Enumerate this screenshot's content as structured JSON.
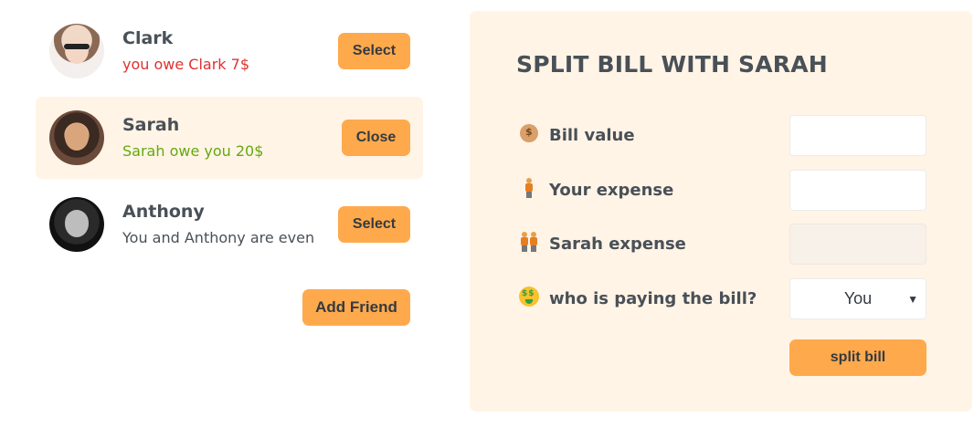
{
  "friends": [
    {
      "name": "Clark",
      "status": "you owe Clark 7$",
      "status_type": "owe",
      "button": "Select",
      "selected": false,
      "avatar": "clark-avatar"
    },
    {
      "name": "Sarah",
      "status": "Sarah owe you 20$",
      "status_type": "owed",
      "button": "Close",
      "selected": true,
      "avatar": "sarah-avatar"
    },
    {
      "name": "Anthony",
      "status": "You and Anthony are even",
      "status_type": "even",
      "button": "Select",
      "selected": false,
      "avatar": "anthony-avatar"
    }
  ],
  "add_friend_label": "Add Friend",
  "split": {
    "title": "SPLIT BILL WITH SARAH",
    "bill_value_label": "Bill value",
    "bill_value_icon": "money-bag-icon",
    "your_expense_label": "Your expense",
    "your_expense_icon": "person-icon",
    "friend_expense_label": "Sarah expense",
    "friend_expense_icon": "people-icon",
    "payer_label": "who is paying the bill?",
    "payer_icon": "money-mouth-face-icon",
    "payer_selected": "You",
    "bill_value": "",
    "your_expense": "",
    "friend_expense": "",
    "submit_label": "split bill"
  },
  "colors": {
    "accent": "#ffa94d",
    "selected_bg": "#fff4e6",
    "owe": "#e03131",
    "owed": "#66a80f",
    "text": "#495057"
  }
}
